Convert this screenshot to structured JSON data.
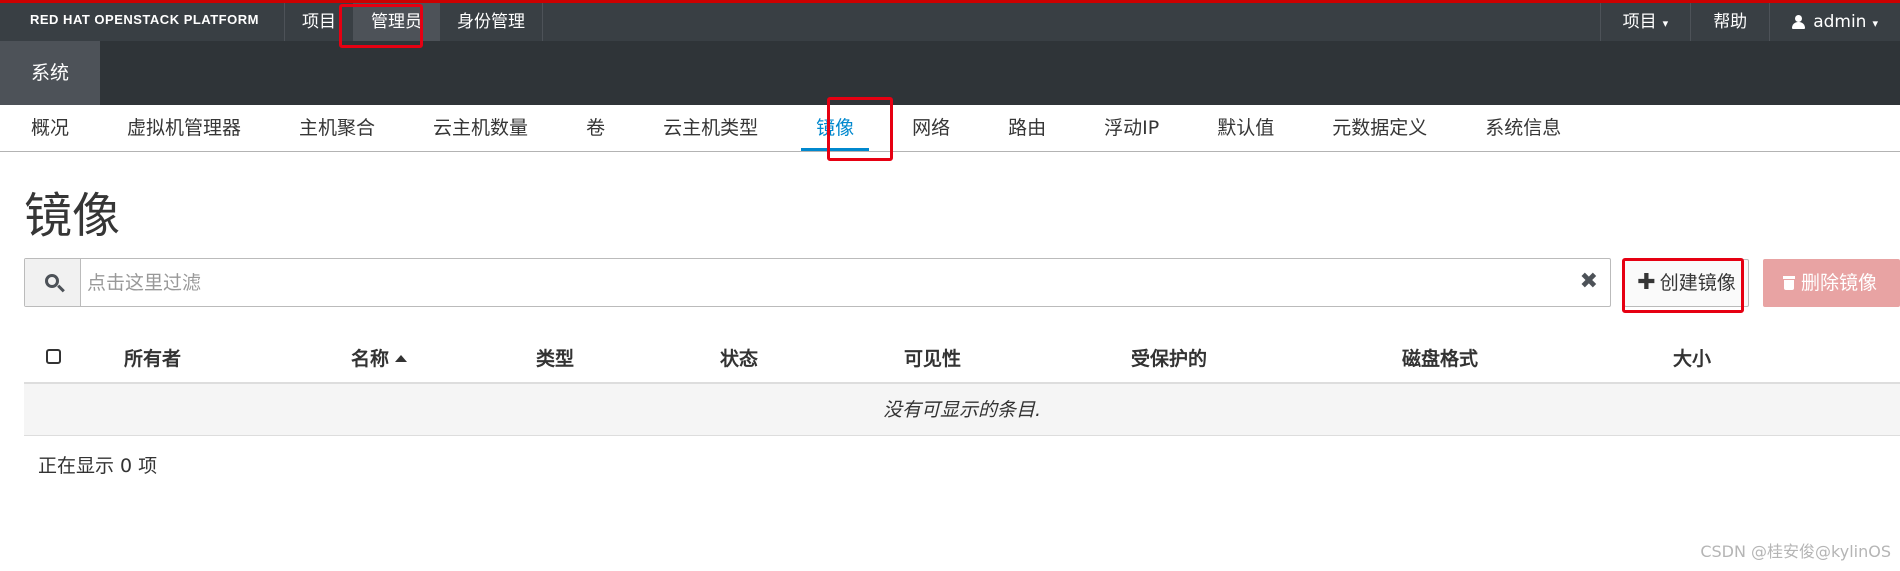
{
  "brand": {
    "name": "RED HAT OPENSTACK PLATFORM"
  },
  "top_nav": {
    "items": [
      "项目",
      "管理员",
      "身份管理"
    ],
    "active_index": 1
  },
  "top_right": {
    "project_label": "项目",
    "help_label": "帮助",
    "user_label": "admin"
  },
  "secondary": {
    "tab_label": "系统"
  },
  "tabs": {
    "items": [
      "概况",
      "虚拟机管理器",
      "主机聚合",
      "云主机数量",
      "卷",
      "云主机类型",
      "镜像",
      "网络",
      "路由",
      "浮动IP",
      "默认值",
      "元数据定义",
      "系统信息"
    ],
    "active_index": 6
  },
  "page": {
    "title": "镜像"
  },
  "filter": {
    "placeholder": "点击这里过滤",
    "value": ""
  },
  "actions": {
    "create_label": "创建镜像",
    "delete_label": "删除镜像"
  },
  "table": {
    "columns": [
      "所有者",
      "名称",
      "类型",
      "状态",
      "可见性",
      "受保护的",
      "磁盘格式",
      "大小"
    ],
    "sorted_column": "名称",
    "sort_direction": "ascending",
    "empty_message": "没有可显示的条目.",
    "count_text": "正在显示 0 项"
  },
  "watermark": "CSDN @桂安俊@kylinOS",
  "colors": {
    "masthead": "#393f44",
    "secondary_bar": "#2f3438",
    "accent_blue": "#0088ce",
    "annotation_red": "#e60012",
    "delete_button": "#e8a3a3"
  }
}
